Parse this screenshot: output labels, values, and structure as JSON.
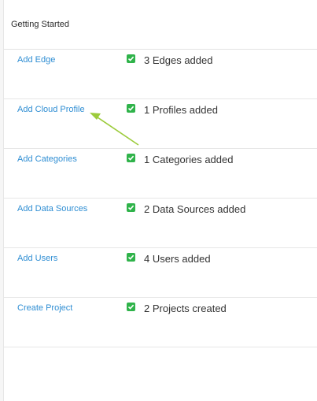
{
  "header": {
    "title": "Getting Started"
  },
  "steps": [
    {
      "link": "Add Edge",
      "status": "3 Edges added"
    },
    {
      "link": "Add Cloud Profile",
      "status": "1 Profiles added"
    },
    {
      "link": "Add Categories",
      "status": "1 Categories added"
    },
    {
      "link": "Add Data Sources",
      "status": "2 Data Sources added"
    },
    {
      "link": "Add Users",
      "status": "4 Users added"
    },
    {
      "link": "Create Project",
      "status": "2 Projects created"
    }
  ],
  "colors": {
    "link": "#2f8ed3",
    "check": "#2fb34a",
    "annotation_arrow": "#9ccb3b"
  },
  "icons": {
    "status": "checkbox-checked-icon",
    "annotation": "arrow-pointer-icon"
  }
}
